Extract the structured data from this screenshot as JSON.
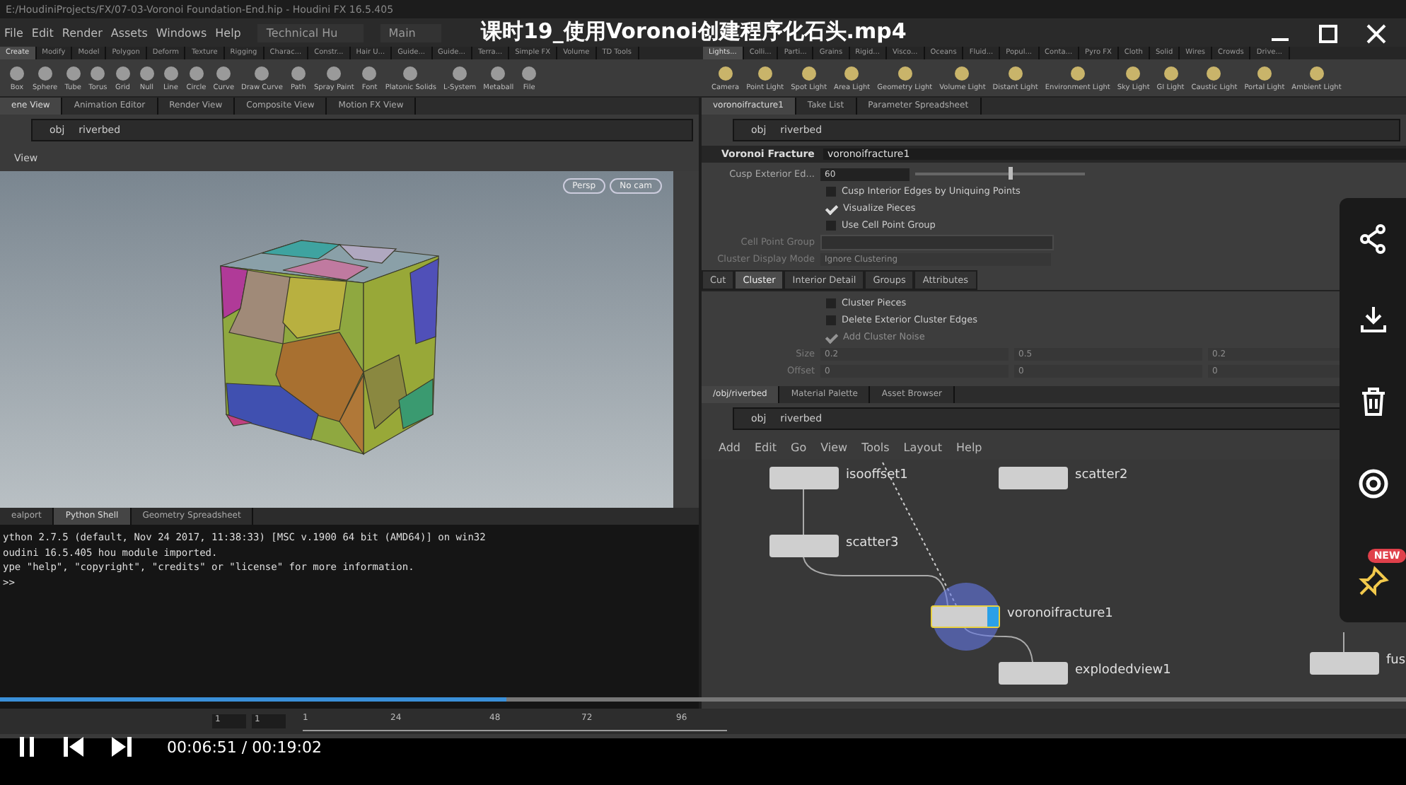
{
  "player": {
    "title": "课时19_使用Voronoi创建程序化石头.mp4",
    "time": "00:06:51 / 00:19:02",
    "progress": {
      "level": 0.36
    },
    "side_actions": [
      {
        "kind": "share"
      },
      {
        "kind": "download"
      },
      {
        "kind": "delete"
      },
      {
        "kind": "record"
      },
      {
        "kind": "pin",
        "badge": "NEW"
      }
    ]
  },
  "houdini": {
    "title": "E:/HoudiniProjects/FX/07-03-Voronoi Foundation-End.hip - Houdini FX 16.5.405",
    "menu": [
      "File",
      "Edit",
      "Render",
      "Assets",
      "Windows",
      "Help"
    ],
    "desktop": "Technical Hu",
    "context": "Main",
    "shelf_tabs": [
      {
        "label": "Create",
        "selected": true
      },
      {
        "label": "Modify",
        "selected": false
      },
      {
        "label": "Model",
        "selected": false
      },
      {
        "label": "Polygon",
        "selected": false
      },
      {
        "label": "Deform",
        "selected": false
      },
      {
        "label": "Texture",
        "selected": false
      },
      {
        "label": "Rigging",
        "selected": false
      },
      {
        "label": "Charac...",
        "selected": false
      },
      {
        "label": "Constr...",
        "selected": false
      },
      {
        "label": "Hair U...",
        "selected": false
      },
      {
        "label": "Guide...",
        "selected": false
      },
      {
        "label": "Guide...",
        "selected": false
      },
      {
        "label": "Terra...",
        "selected": false
      },
      {
        "label": "Simple FX",
        "selected": false
      },
      {
        "label": "Volume",
        "selected": false
      },
      {
        "label": "TD Tools",
        "selected": false
      }
    ],
    "shelf_tabs_right": [
      {
        "label": "Lights...",
        "selected": true
      },
      {
        "label": "Colli...",
        "selected": false
      },
      {
        "label": "Parti...",
        "selected": false
      },
      {
        "label": "Grains",
        "selected": false
      },
      {
        "label": "Rigid...",
        "selected": false
      },
      {
        "label": "Visco...",
        "selected": false
      },
      {
        "label": "Oceans",
        "selected": false
      },
      {
        "label": "Fluid...",
        "selected": false
      },
      {
        "label": "Popul...",
        "selected": false
      },
      {
        "label": "Conta...",
        "selected": false
      },
      {
        "label": "Pyro FX",
        "selected": false
      },
      {
        "label": "Cloth",
        "selected": false
      },
      {
        "label": "Solid",
        "selected": false
      },
      {
        "label": "Wires",
        "selected": false
      },
      {
        "label": "Crowds",
        "selected": false
      },
      {
        "label": "Drive...",
        "selected": false
      }
    ],
    "shelf_tools": [
      "Box",
      "Sphere",
      "Tube",
      "Torus",
      "Grid",
      "Null",
      "Line",
      "Circle",
      "Curve",
      "Draw Curve",
      "Path",
      "Spray Paint",
      "Font",
      "Platonic Solids",
      "L-System",
      "Metaball",
      "File"
    ],
    "shelf_tools_right": [
      "Camera",
      "Point Light",
      "Spot Light",
      "Area Light",
      "Geometry Light",
      "Volume Light",
      "Distant Light",
      "Environment Light",
      "Sky Light",
      "GI Light",
      "Caustic Light",
      "Portal Light",
      "Ambient Light"
    ],
    "viewer_tabs": [
      {
        "label": "ene View",
        "selected": true
      },
      {
        "label": "Animation Editor",
        "selected": false
      },
      {
        "label": "Render View",
        "selected": false
      },
      {
        "label": "Composite View",
        "selected": false
      },
      {
        "label": "Motion FX View",
        "selected": false
      }
    ],
    "viewer_path": [
      "obj",
      "riverbed"
    ],
    "viewer_label": "View",
    "camera_buttons": [
      "Persp",
      "No cam"
    ],
    "shell_tabs": [
      {
        "label": "ealport",
        "selected": false
      },
      {
        "label": "Python Shell",
        "selected": true
      },
      {
        "label": "Geometry Spreadsheet",
        "selected": false
      }
    ],
    "console_lines": [
      "ython 2.7.5 (default, Nov 24 2017, 11:38:33) [MSC v.1900 64 bit (AMD64)] on win32",
      "oudini 16.5.405 hou module imported.",
      "ype \"help\", \"copyright\", \"credits\" or \"license\" for more information.",
      ">>"
    ],
    "param_tabs": [
      {
        "label": "voronoifracture1",
        "selected": true
      },
      {
        "label": "Take List",
        "selected": false
      },
      {
        "label": "Parameter Spreadsheet",
        "selected": false
      }
    ],
    "param_path": [
      "obj",
      "riverbed"
    ],
    "parameters": {
      "node_type": "Voronoi Fracture",
      "node_name": "voronoifracture1",
      "rows": [
        {
          "kind": "slider",
          "label": "Cusp Exterior Ed...",
          "value": "60",
          "level": 0.55,
          "disabled": false
        },
        {
          "kind": "checkbox",
          "label": "Cusp Interior Edges by Uniquing Points",
          "checked": false,
          "disabled": false
        },
        {
          "kind": "checkbox",
          "label": "Visualize Pieces",
          "checked": true,
          "disabled": false
        },
        {
          "kind": "checkbox",
          "label": "Use Cell Point Group",
          "checked": false,
          "disabled": false
        },
        {
          "kind": "field",
          "label": "Cell Point Group",
          "disabled": true
        },
        {
          "kind": "menu",
          "label": "Cluster Display Mode",
          "value": "Ignore Clustering",
          "disabled": true
        }
      ],
      "tabs": [
        {
          "label": "Cut",
          "selected": false
        },
        {
          "label": "Cluster",
          "selected": true
        },
        {
          "label": "Interior Detail",
          "selected": false
        },
        {
          "label": "Groups",
          "selected": false
        },
        {
          "label": "Attributes",
          "selected": false
        }
      ],
      "tab_rows": [
        {
          "kind": "checkbox",
          "label": "Cluster Pieces",
          "checked": false,
          "disabled": false
        },
        {
          "kind": "checkbox",
          "label": "Delete Exterior Cluster Edges",
          "checked": false,
          "disabled": false
        },
        {
          "kind": "checkbox",
          "label": "Add Cluster Noise",
          "checked": true,
          "disabled": true
        },
        {
          "kind": "vector",
          "label": "Size",
          "values": [
            "0.2",
            "0.5",
            "0.2"
          ],
          "disabled": true
        },
        {
          "kind": "vector",
          "label": "Offset",
          "values": [
            "0",
            "0",
            "0"
          ],
          "disabled": true
        }
      ]
    },
    "network_tabs": [
      {
        "label": "/obj/riverbed",
        "selected": true
      },
      {
        "label": "Material Palette",
        "selected": false
      },
      {
        "label": "Asset Browser",
        "selected": false
      }
    ],
    "network_path": [
      "obj",
      "riverbed"
    ],
    "network_menu": [
      "Add",
      "Edit",
      "Go",
      "View",
      "Tools",
      "Layout",
      "Help"
    ],
    "nodes": [
      {
        "name": "isooffset1",
        "selected": false,
        "display": false
      },
      {
        "name": "scatter2",
        "selected": false,
        "display": false
      },
      {
        "name": "scatter3",
        "selected": false,
        "display": false
      },
      {
        "name": "voronoifracture1",
        "selected": true,
        "display": true
      },
      {
        "name": "explodedview1",
        "selected": false,
        "display": false
      },
      {
        "name": "fus",
        "selected": false,
        "display": false
      }
    ],
    "playbar": {
      "start": "1",
      "current": "1",
      "ticks": [
        "1",
        "24",
        "48",
        "72",
        "96"
      ]
    }
  }
}
